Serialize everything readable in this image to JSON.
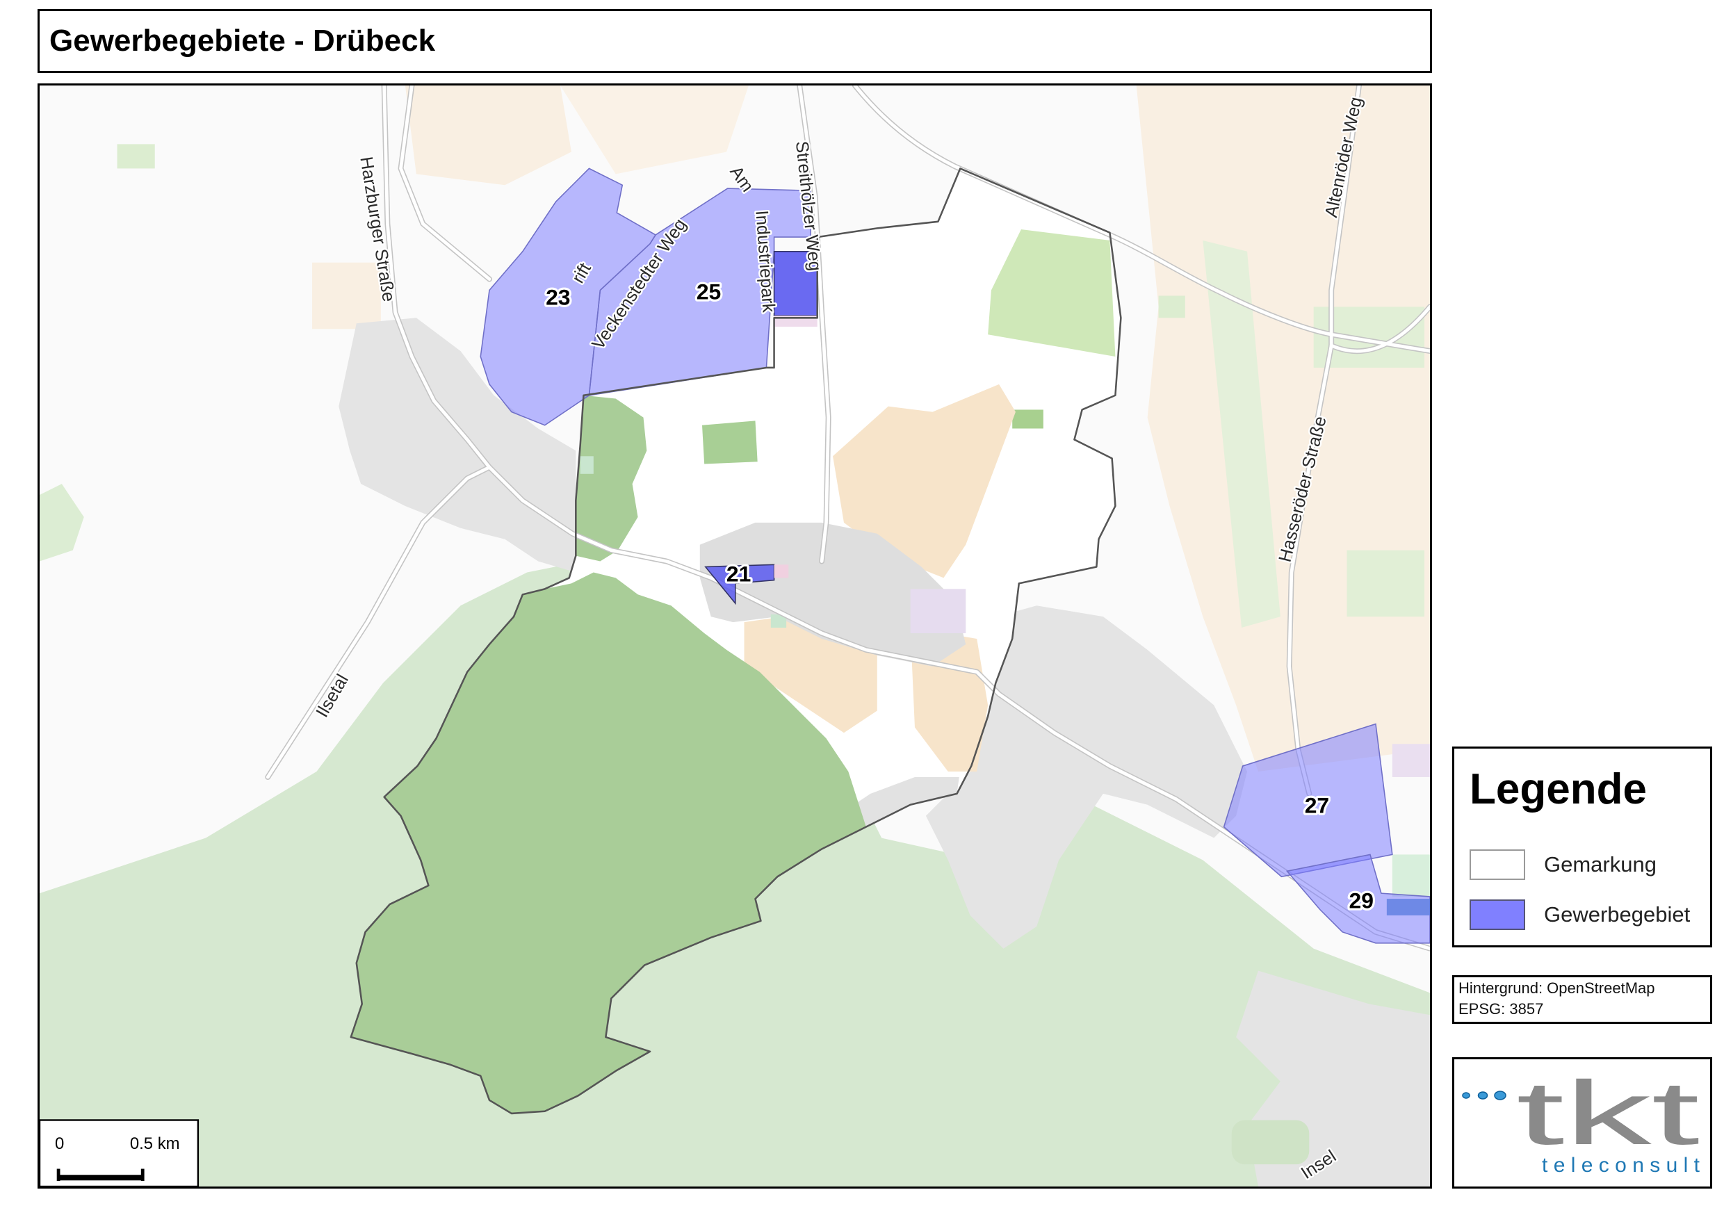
{
  "title": "Gewerbegebiete - Drübeck",
  "map": {
    "areas": {
      "a21": "21",
      "a23": "23",
      "a25": "25",
      "a27": "27",
      "a29": "29"
    },
    "streets": {
      "harzburger": "Harzburger Straße",
      "veckenstedter": "Veckenstedter Weg",
      "trift": "rift",
      "am": "Am",
      "industriepark": "Industriepark",
      "streithoelzer": "Streithölzer Weg",
      "altenroeder": "Altenröder Weg",
      "hasseroeder": "Hasseröder Straße",
      "ilsetal": "Ilsetal",
      "insel": "Insel"
    },
    "scalebar": {
      "start": "0",
      "end": "0.5 km"
    }
  },
  "legend": {
    "title": "Legende",
    "items": [
      {
        "label": "Gemarkung",
        "color": "#ffffff"
      },
      {
        "label": "Gewerbegebiet",
        "color": "#8080ff"
      }
    ]
  },
  "info": {
    "background": "Hintergrund: OpenStreetMap",
    "epsg": "EPSG: 3857"
  },
  "logo": {
    "mark": "tkt",
    "name": "teleconsult"
  },
  "colors": {
    "gemarkung_fill": "#ffffff",
    "gemarkung_border": "#555555",
    "gewerbegebiet_fill": "#8080ff",
    "gewerbegebiet_dark": "#5a5af0",
    "forest": "#a9cd98",
    "logo_gray": "#8a8a8a",
    "logo_blue": "#1f78b4"
  }
}
